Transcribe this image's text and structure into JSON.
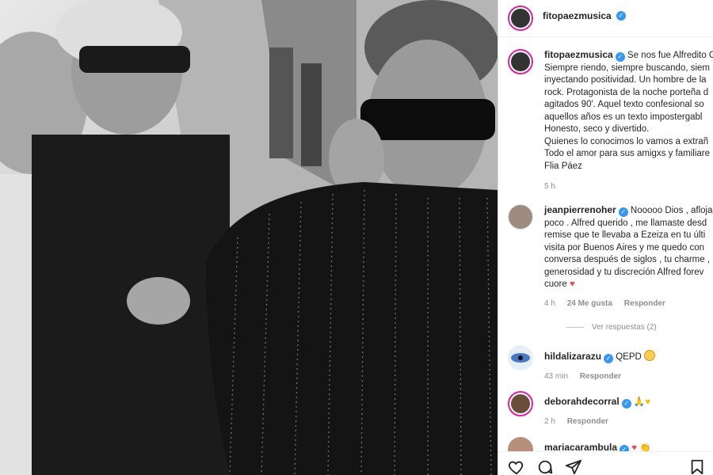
{
  "post": {
    "username": "fitopaezmusica",
    "caption_lines": [
      "Se nos fue Alfredito G",
      "Siempre riendo, siempre buscando, siem",
      "inyectando positividad. Un hombre de la",
      "rock. Protagonista de la noche porteña d",
      "agitados 90'. Aquel texto confesional so",
      "aquellos años es un texto impostergabl",
      "Honesto, seco y divertido.",
      "Quienes lo conocimos lo vamos a extrañ",
      "Todo el amor para sus amigxs y familiare",
      "Flia Páez"
    ],
    "caption_time": "5 h"
  },
  "comments": [
    {
      "username": "jeanpierrenoher",
      "lines": [
        "Nooooo Dios , afloja",
        "poco . Alfred querido , me llamaste desd",
        "remise que te llevaba a Ezeiza en tu últi",
        "visita por Buenos Aires y me quedo con",
        "conversa después de siglos , tu charme ,",
        "generosidad y tu discreción Alfred forev",
        "cuore"
      ],
      "emoji": "red-heart",
      "time": "4 h",
      "likes": "24 Me gusta",
      "reply": "Responder",
      "view_replies": "Ver respuestas (2)"
    },
    {
      "username": "hildalizarazu",
      "text": "QEPD",
      "emoji": "sad-face",
      "time": "43 min",
      "reply": "Responder"
    },
    {
      "username": "deborahdecorral",
      "emoji": "praying-hands, yellow-heart",
      "time": "2 h",
      "reply": "Responder"
    },
    {
      "username": "mariacarambula",
      "emoji": "red-heart, clapping"
    }
  ],
  "icons": [
    "heart-icon",
    "comment-icon",
    "share-icon",
    "save-icon",
    "verified-badge-icon"
  ],
  "colors": {
    "verified": "#3897f0",
    "heart": "#ed4956",
    "muted": "#8e8e8e",
    "text": "#262626",
    "ring": "#d6249f"
  }
}
